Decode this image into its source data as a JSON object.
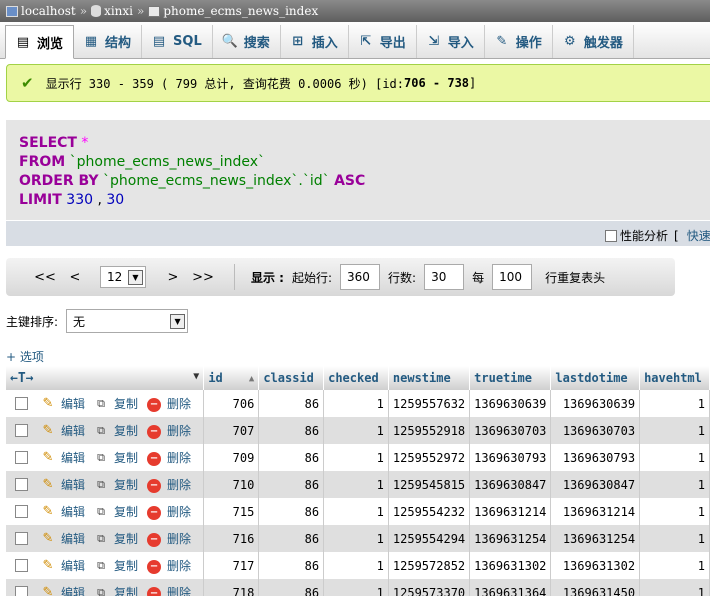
{
  "breadcrumb": {
    "server": "localhost",
    "database": "xinxi",
    "table": "phome_ecms_news_index",
    "sep": "»"
  },
  "tabs": [
    {
      "label": "浏览",
      "icon": "browse-icon",
      "glyph": "▤",
      "active": true
    },
    {
      "label": "结构",
      "icon": "structure-icon",
      "glyph": "▦"
    },
    {
      "label": "SQL",
      "icon": "sql-icon",
      "glyph": "▤"
    },
    {
      "label": "搜索",
      "icon": "search-icon",
      "glyph": "🔍"
    },
    {
      "label": "插入",
      "icon": "insert-icon",
      "glyph": "⊞"
    },
    {
      "label": "导出",
      "icon": "export-icon",
      "glyph": "⇱"
    },
    {
      "label": "导入",
      "icon": "import-icon",
      "glyph": "⇲"
    },
    {
      "label": "操作",
      "icon": "wrench-icon",
      "glyph": "✎"
    },
    {
      "label": "触发器",
      "icon": "trigger-icon",
      "glyph": "⚙"
    }
  ],
  "success": {
    "text": "显示行 330 - 359 ( 799 总计, 查询花费 0.0006 秒) [id: ",
    "range": "706 - 738",
    "close": "]"
  },
  "sql": {
    "l1_kw": "SELECT",
    "l1_op": "*",
    "l2_kw": "FROM",
    "l2_str": "`phome_ecms_news_index`",
    "l3_kw": "ORDER BY",
    "l3_str": "`phome_ecms_news_index`.`id`",
    "l3_kw2": "ASC",
    "l4_kw": "LIMIT",
    "l4_a": "330",
    "l4_b": "30"
  },
  "profiling": {
    "label": "性能分析",
    "bracket": "[",
    "quick": "快速编辑"
  },
  "nav": {
    "first": "<<",
    "prev": "<",
    "page": "12",
    "next": ">",
    "last": ">>",
    "show_label": "显示 :",
    "start_label": "起始行:",
    "start": "360",
    "rows_label": "行数:",
    "rows": "30",
    "each_label": "每",
    "repeat": "100",
    "repeat_label": "行重复表头"
  },
  "sortkey": {
    "label": "主键排序:",
    "value": "无"
  },
  "options_label": "+ 选项",
  "table": {
    "columns": [
      "id",
      "classid",
      "checked",
      "newstime",
      "truetime",
      "lastdotime",
      "havehtml"
    ],
    "sort_glyph": "▲",
    "edit": "编辑",
    "copy": "复制",
    "delete": "删除",
    "rows": [
      [
        "706",
        "86",
        "1",
        "1259557632",
        "1369630639",
        "1369630639",
        "1"
      ],
      [
        "707",
        "86",
        "1",
        "1259552918",
        "1369630703",
        "1369630703",
        "1"
      ],
      [
        "709",
        "86",
        "1",
        "1259552972",
        "1369630793",
        "1369630793",
        "1"
      ],
      [
        "710",
        "86",
        "1",
        "1259545815",
        "1369630847",
        "1369630847",
        "1"
      ],
      [
        "715",
        "86",
        "1",
        "1259554232",
        "1369631214",
        "1369631214",
        "1"
      ],
      [
        "716",
        "86",
        "1",
        "1259554294",
        "1369631254",
        "1369631254",
        "1"
      ],
      [
        "717",
        "86",
        "1",
        "1259572852",
        "1369631302",
        "1369631302",
        "1"
      ],
      [
        "718",
        "86",
        "1",
        "1259573370",
        "1369631364",
        "1369631450",
        "1"
      ]
    ]
  }
}
